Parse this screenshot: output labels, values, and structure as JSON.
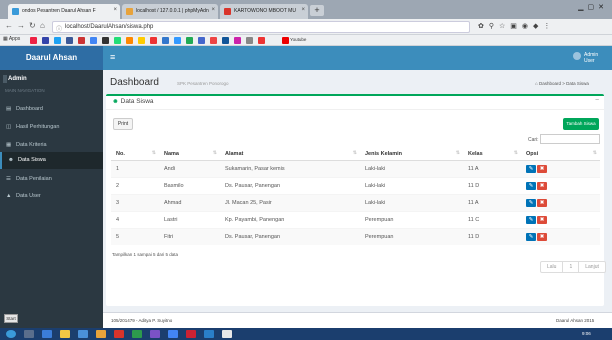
{
  "browser": {
    "tabs": [
      {
        "title": "ondos Pesantren Daarul Ahsan F"
      },
      {
        "title": "localhost / 127.0.0.1 | phpMyAdn"
      },
      {
        "title": "KARTOWONO MBOOT MU"
      }
    ],
    "url": "localhost/DaarulAhsan/siswa.php",
    "bookmarks": {
      "apps": "Apps",
      "youtube": "Youtube"
    }
  },
  "app": {
    "brand": "Daarul Ahsan",
    "user_top": "Admin",
    "user_top_sub": "User",
    "user_name": "Admin",
    "user_sub": "MAIN NAVIGATION"
  },
  "sidebar": {
    "items": [
      {
        "label": "Dashboard",
        "icon": "dashboard-icon",
        "glyph": "▤"
      },
      {
        "label": "Hasil Perhitungan",
        "icon": "chart-icon",
        "glyph": "◫"
      },
      {
        "label": "Data Kriteria",
        "icon": "book-icon",
        "glyph": "▦"
      },
      {
        "label": "Data Siswa",
        "icon": "users-icon",
        "glyph": "☻"
      },
      {
        "label": "Data Penilaian",
        "icon": "list-icon",
        "glyph": "☰"
      },
      {
        "label": "Data User",
        "icon": "user-icon",
        "glyph": "▲"
      }
    ],
    "start": "Start"
  },
  "page": {
    "title": "Dashboard",
    "subtitle": "SPK Pesantren Ponorogo",
    "breadcrumb_home": "Dashboard",
    "breadcrumb_sep": ">",
    "breadcrumb_current": "Data Siswa"
  },
  "box": {
    "title": "Data Siswa",
    "print_label": "Print",
    "add_label": "Tambah Siswa",
    "search_label": "Cari:",
    "search_value": "",
    "columns": [
      "No.",
      "Nama",
      "Alamat",
      "Jenis Kelamin",
      "Kelas",
      "Opsi"
    ],
    "rows": [
      {
        "no": "1",
        "nama": "Andi",
        "alamat": "Sukamarin, Pasar kemis",
        "jk": "Laki-laki",
        "kelas": "11 A"
      },
      {
        "no": "2",
        "nama": "Basmilo",
        "alamat": "Ds. Pausar, Panengan",
        "jk": "Laki-laki",
        "kelas": "11 D"
      },
      {
        "no": "3",
        "nama": "Ahmad",
        "alamat": "Jl. Macan 25, Pasir",
        "jk": "Laki-laki",
        "kelas": "11 A"
      },
      {
        "no": "4",
        "nama": "Lastri",
        "alamat": "Kp. Payambi, Panengan",
        "jk": "Perempuan",
        "kelas": "11 C"
      },
      {
        "no": "5",
        "nama": "Fitri",
        "alamat": "Ds. Pausar, Panengan",
        "jk": "Perempuan",
        "kelas": "11 D"
      }
    ],
    "edit_glyph": "✎",
    "delete_glyph": "✖",
    "info": "Tampilkan 1 sampai 5 dari 5 data",
    "pager": {
      "prev": "Lalu",
      "page": "1",
      "next": "Lanjut"
    }
  },
  "footer": {
    "left": "105/201479 - Aditya P. Suyitno",
    "right": "Daarul Ahsan 2015"
  },
  "taskbar": {
    "clock": "9:06"
  },
  "colors": {
    "topbar": "#3c8dbc",
    "sidebar": "#2b3841",
    "success": "#00a65a",
    "edit": "#0073b7",
    "delete": "#dd4b39"
  }
}
